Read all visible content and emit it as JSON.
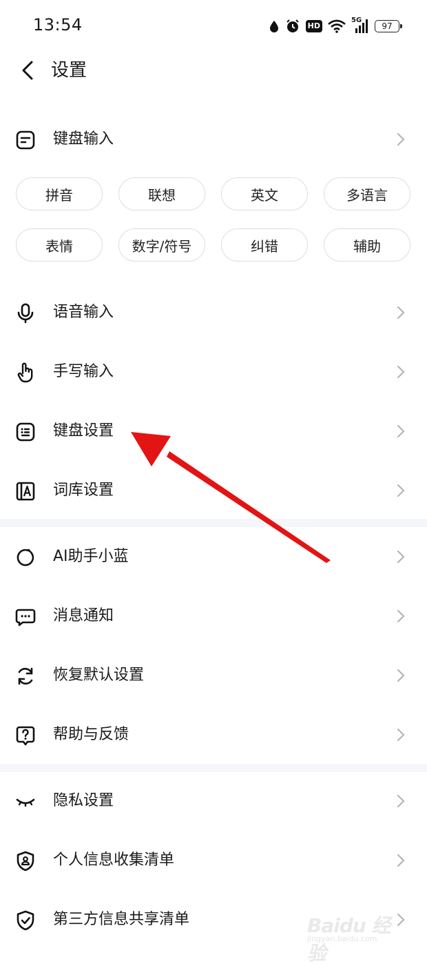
{
  "status_bar": {
    "time": "13:54",
    "network": "5G",
    "hd": "HD",
    "battery": "97",
    "icons": [
      "drop-icon",
      "alarm-icon",
      "hd-icon",
      "wifi-icon",
      "signal-5g-icon",
      "battery-icon"
    ]
  },
  "header": {
    "title": "设置",
    "back_icon": "back-arrow-icon"
  },
  "keyboard_input": {
    "label": "键盘输入",
    "chips": [
      "拼音",
      "联想",
      "英文",
      "多语言",
      "表情",
      "数字/符号",
      "纠错",
      "辅助"
    ]
  },
  "section1": [
    {
      "label": "语音输入",
      "icon": "microphone-icon"
    },
    {
      "label": "手写输入",
      "icon": "hand-pointer-icon"
    },
    {
      "label": "键盘设置",
      "icon": "keyboard-icon"
    },
    {
      "label": "词库设置",
      "icon": "dictionary-icon"
    }
  ],
  "section2": [
    {
      "label": "AI助手小蓝",
      "icon": "ai-assistant-icon"
    },
    {
      "label": "消息通知",
      "icon": "message-icon"
    },
    {
      "label": "恢复默认设置",
      "icon": "refresh-icon"
    },
    {
      "label": "帮助与反馈",
      "icon": "help-icon"
    }
  ],
  "section3": [
    {
      "label": "隐私设置",
      "icon": "eye-closed-icon"
    },
    {
      "label": "个人信息收集清单",
      "icon": "shield-user-icon"
    },
    {
      "label": "第三方信息共享清单",
      "icon": "shield-check-icon"
    }
  ],
  "watermark": {
    "brand": "Baidu 经验",
    "url": "jingyan.baidu.com"
  },
  "colors": {
    "annotation_arrow": "#ee1c1c",
    "divider": "#f4f6f9",
    "chip_border": "#dddddd"
  }
}
